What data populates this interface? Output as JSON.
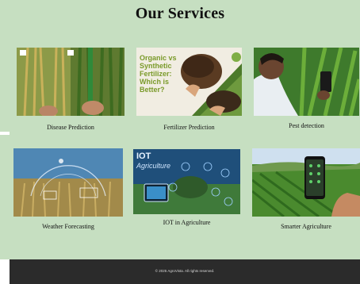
{
  "page": {
    "title": "Our Services"
  },
  "services": [
    {
      "caption": "Disease Prediction",
      "image": "wheat-field-photo"
    },
    {
      "caption": "Fertilizer Prediction",
      "image": "fertilizer-soil-photo",
      "overlay": "Organic vs Synthetic Fertilizer: Which is Better?"
    },
    {
      "caption": "Pest detection",
      "image": "farmer-with-phone-photo"
    },
    {
      "caption": "Weather Forecasting",
      "image": "wheat-field-dashboard-photo"
    },
    {
      "caption": "IOT in Agriculture",
      "image": "iot-smart-farm-graphic",
      "overlay_title": "IOT",
      "overlay_sub": "Agriculture"
    },
    {
      "caption": "Smarter Agriculture",
      "image": "smartphone-in-field-photo"
    }
  ],
  "footer": {
    "text": "© 2025 AgroVista. All rights reserved."
  }
}
